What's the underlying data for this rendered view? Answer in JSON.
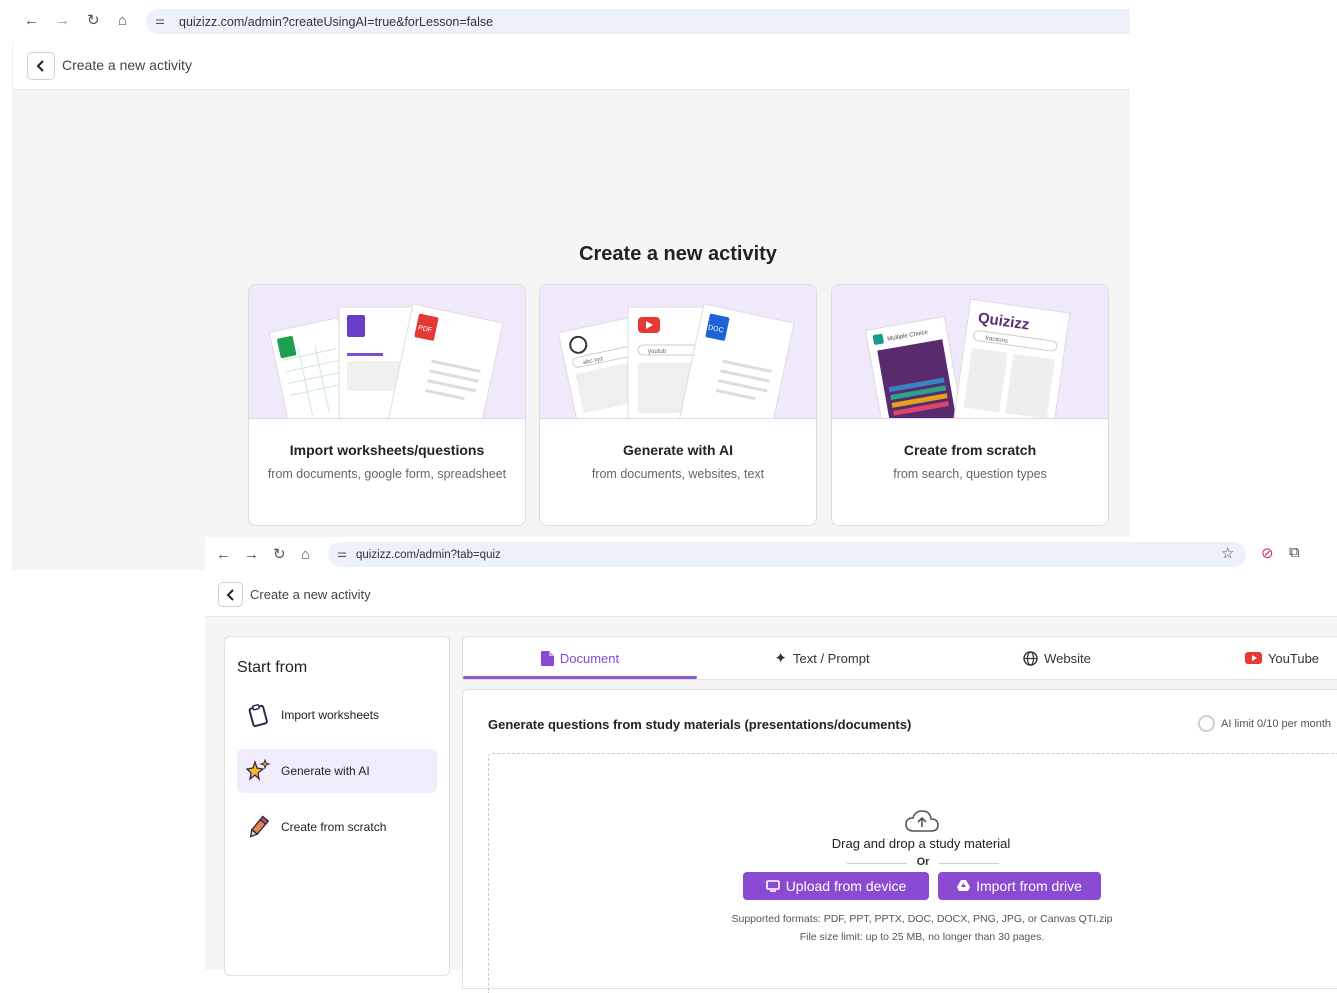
{
  "top_window": {
    "url": "quizizz.com/admin?createUsingAI=true&forLesson=false",
    "header_title": "Create a new activity",
    "main_title": "Create a new activity",
    "cards": [
      {
        "title": "Import worksheets/questions",
        "subtitle": "from documents, google form, spreadsheet",
        "doc_labels": [
          "PDF"
        ]
      },
      {
        "title": "Generate with AI",
        "subtitle": "from documents, websites, text",
        "doc_labels": [
          "abc.xyz",
          "youtub",
          "DOC"
        ]
      },
      {
        "title": "Create from scratch",
        "subtitle": "from search, question types",
        "doc_labels": [
          "Multiple Choice",
          "Quizizz",
          "fractions"
        ]
      }
    ]
  },
  "bottom_window": {
    "url": "quizizz.com/admin?tab=quiz",
    "header_title": "Create a new activity",
    "sidebar": {
      "title": "Start from",
      "items": [
        {
          "label": "Import worksheets",
          "icon": "clipboard-icon",
          "active": false
        },
        {
          "label": "Generate with AI",
          "icon": "sparkle-stars-icon",
          "active": true
        },
        {
          "label": "Create from scratch",
          "icon": "pencil-icon",
          "active": false
        }
      ]
    },
    "tabs": [
      {
        "label": "Document",
        "icon": "document-icon",
        "active": true
      },
      {
        "label": "Text / Prompt",
        "icon": "sparkle-icon",
        "active": false
      },
      {
        "label": "Website",
        "icon": "globe-icon",
        "active": false
      },
      {
        "label": "YouTube",
        "icon": "youtube-icon",
        "active": false
      }
    ],
    "panel": {
      "heading": "Generate questions from study materials (presentations/documents)",
      "ai_limit": "AI limit 0/10 per month",
      "drop_title": "Drag and drop a study material",
      "or_label": "Or",
      "upload_label": "Upload from device",
      "drive_label": "Import from drive",
      "formats_note": "Supported formats: PDF, PPT, PPTX, DOC, DOCX, PNG, JPG, or Canvas QTI.zip",
      "size_note": "File size limit: up to 25 MB, no longer than 30 pages."
    }
  },
  "colors": {
    "accent": "#8a4ad1",
    "card_illustration_bg": "#efe9fb",
    "page_bg": "#f5f5f5"
  }
}
